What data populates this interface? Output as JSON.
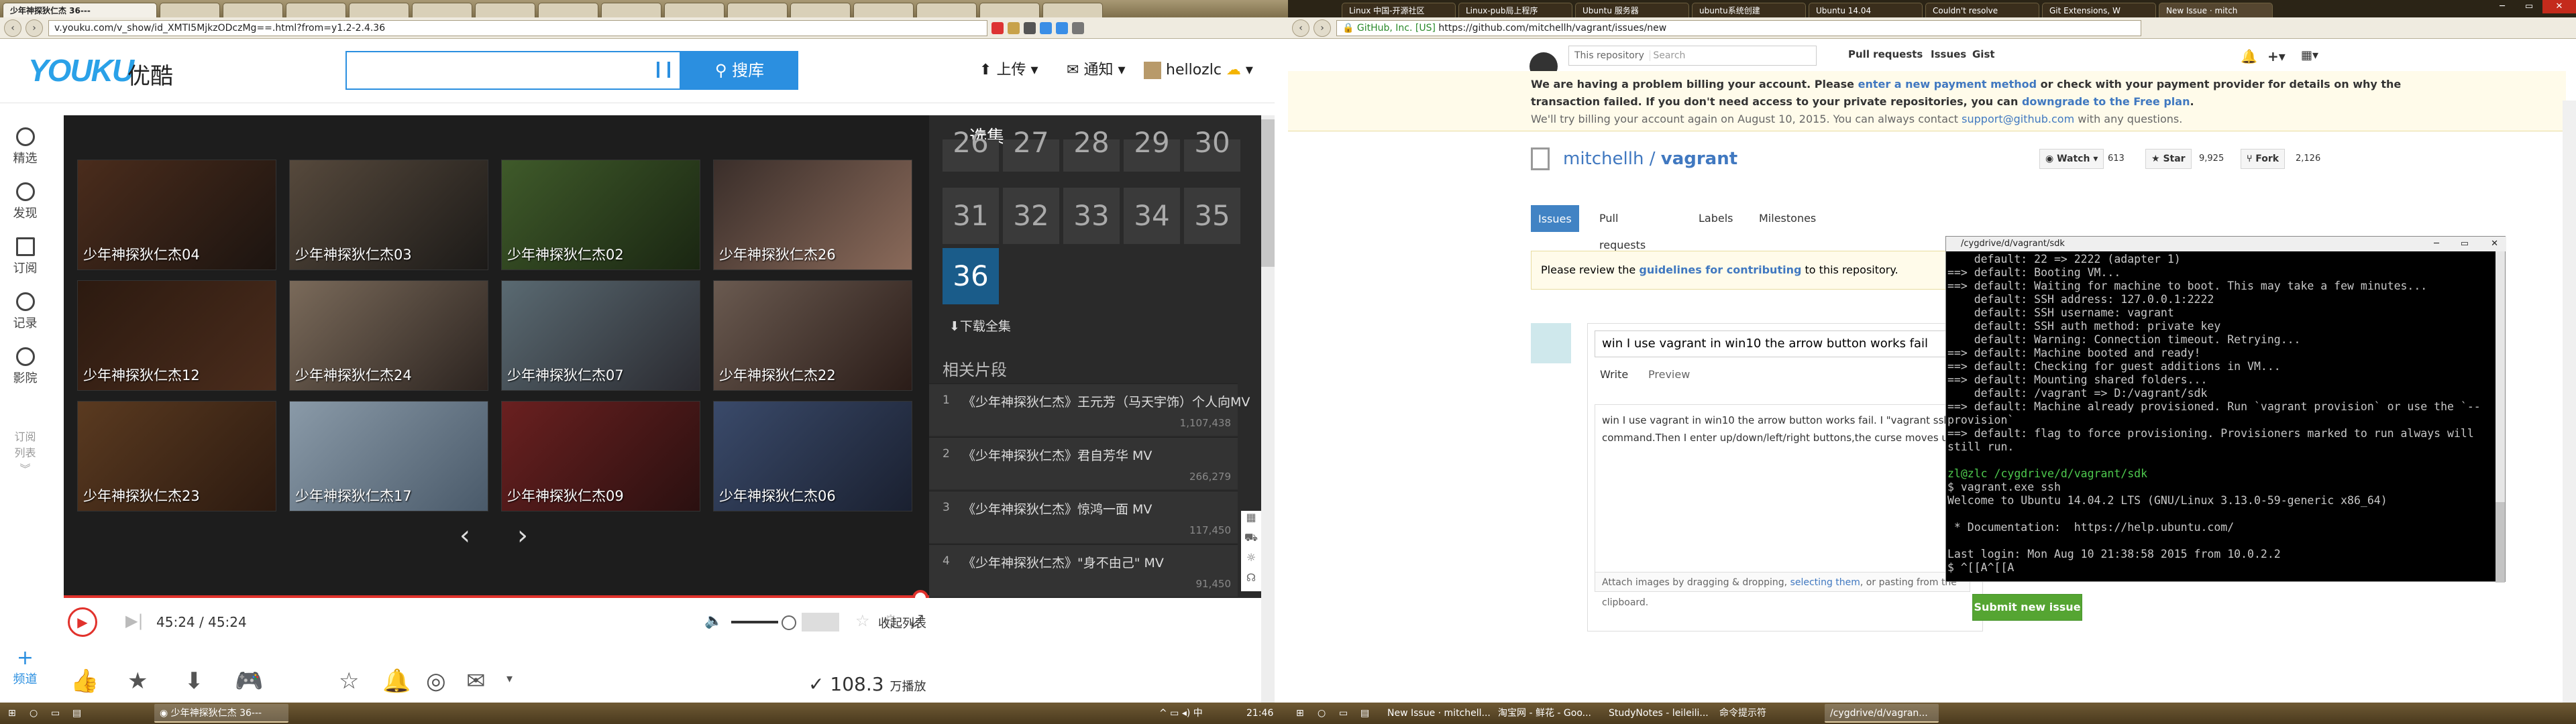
{
  "left": {
    "tabs": [
      "少年神探狄仁杰 36---",
      "",
      "",
      "",
      "",
      "",
      "",
      "",
      "",
      "",
      "",
      "",
      "",
      "",
      "",
      ""
    ],
    "url": "v.youku.com/v_show/id_XMTI5MjkzODczMg==.html?from=y1.2-2.4.36",
    "logo": "YOUKU",
    "logo_cn": "优酷",
    "search_btn": "搜库",
    "upload": "上传",
    "notify": "通知",
    "user": "hellozlc",
    "side": [
      "精选",
      "发现",
      "订阅",
      "记录",
      "影院",
      "订阅",
      "列表",
      "频道"
    ],
    "thumbs": [
      "少年神探狄仁杰04",
      "少年神探狄仁杰03",
      "少年神探狄仁杰02",
      "少年神探狄仁杰26",
      "少年神探狄仁杰12",
      "少年神探狄仁杰24",
      "少年神探狄仁杰07",
      "少年神探狄仁杰22",
      "少年神探狄仁杰23",
      "少年神探狄仁杰17",
      "少年神探狄仁杰09",
      "少年神探狄仁杰06"
    ],
    "ep_panel_title": "选集",
    "episodes": [
      "26",
      "27",
      "28",
      "29",
      "30",
      "31",
      "32",
      "33",
      "34",
      "35",
      "36"
    ],
    "selected_ep": "36",
    "download_all": "下载全集",
    "related_title": "相关片段",
    "related": [
      {
        "n": "1",
        "t": "《少年神探狄仁杰》王元芳（马天宇饰）个人向MV",
        "c": "1,107,438"
      },
      {
        "n": "2",
        "t": "《少年神探狄仁杰》君自芳华 MV",
        "c": "266,279"
      },
      {
        "n": "3",
        "t": "《少年神探狄仁杰》惊鸿一面 MV",
        "c": "117,450"
      },
      {
        "n": "4",
        "t": "《少年神探狄仁杰》\"身不由己\" MV",
        "c": "91,450"
      }
    ],
    "time": "45:24 / 45:24",
    "playlist": "收起列表",
    "views": "108.3",
    "views_unit": "万播放",
    "progress": 1.0
  },
  "taskbar_left": {
    "item": "少年神探狄仁杰 36---",
    "clock": "21:46"
  },
  "right": {
    "tabs": [
      "Linux 中国-开源社区",
      "Linux-pub局上程序",
      "Ubuntu 服务器",
      "ubuntu系统创建",
      "Ubuntu 14.04",
      "Couldn't resolve",
      "Git Extensions, W",
      "New Issue · mitch"
    ],
    "url_secure": "GitHub, Inc. [US]",
    "url": "https://github.com/mitchellh/vagrant/issues/new",
    "this_repo": "This repository",
    "search_ph": "Search",
    "nav": [
      "Pull requests",
      "Issues",
      "Gist"
    ],
    "billing1": "We are having a problem billing your account. Please",
    "billing_link1": "enter a new payment method",
    "billing2": "or check with your payment provider for details on why the",
    "billing3": "transaction failed. If you don't need access to your private repositories, you can",
    "billing_link2": "downgrade to the Free plan",
    "billing4": "We'll try billing your account again on August 10, 2015. You can always contact",
    "billing_link3": "support@github.com",
    "billing5": "with any questions.",
    "owner": "mitchellh",
    "repo": "vagrant",
    "watch": "Watch",
    "watch_n": "613",
    "star": "Star",
    "star_n": "9,925",
    "fork": "Fork",
    "fork_n": "2,126",
    "tabs_repo": [
      "Issues",
      "Pull requests",
      "Labels",
      "Milestones"
    ],
    "guide1": "Please review the",
    "guide_link": "guidelines for contributing",
    "guide2": "to this repository.",
    "issue_title": "win I use vagrant in win10 the arrow button works fail",
    "write": "Write",
    "preview": "Preview",
    "body": "win I use vagrant in win10 the arrow button works fail. I \"vagrant ssh\" command.Then I enter up/down/left/right buttons,the curse moves up",
    "attach": "Attach images by dragging & dropping,",
    "attach_link": "selecting them",
    "attach2": ", or pasting from the clipboard.",
    "submit": "Submit new issue"
  },
  "terminal": {
    "title": "/cygdrive/d/vagrant/sdk",
    "lines": [
      "    default: 22 => 2222 (adapter 1)",
      "==> default: Booting VM...",
      "==> default: Waiting for machine to boot. This may take a few minutes...",
      "    default: SSH address: 127.0.0.1:2222",
      "    default: SSH username: vagrant",
      "    default: SSH auth method: private key",
      "    default: Warning: Connection timeout. Retrying...",
      "==> default: Machine booted and ready!",
      "==> default: Checking for guest additions in VM...",
      "==> default: Mounting shared folders...",
      "    default: /vagrant => D:/vagrant/sdk",
      "==> default: Machine already provisioned. Run `vagrant provision` or use the `--",
      "provision`",
      "==> default: flag to force provisioning. Provisioners marked to run always will",
      "still run.",
      "",
      "zl@zlc /cygdrive/d/vagrant/sdk",
      "$ vagrant.exe ssh",
      "Welcome to Ubuntu 14.04.2 LTS (GNU/Linux 3.13.0-59-generic x86_64)",
      "",
      " * Documentation:  https://help.ubuntu.com/",
      "",
      "Last login: Mon Aug 10 21:38:58 2015 from 10.0.2.2",
      "$ ^[[A^[[A"
    ]
  },
  "taskbar_right": [
    "New Issue · mitchell...",
    "淘宝网 - 鲜花 - Goo...",
    "StudyNotes - leileili...",
    "命令提示符",
    "/cygdrive/d/vagran..."
  ]
}
